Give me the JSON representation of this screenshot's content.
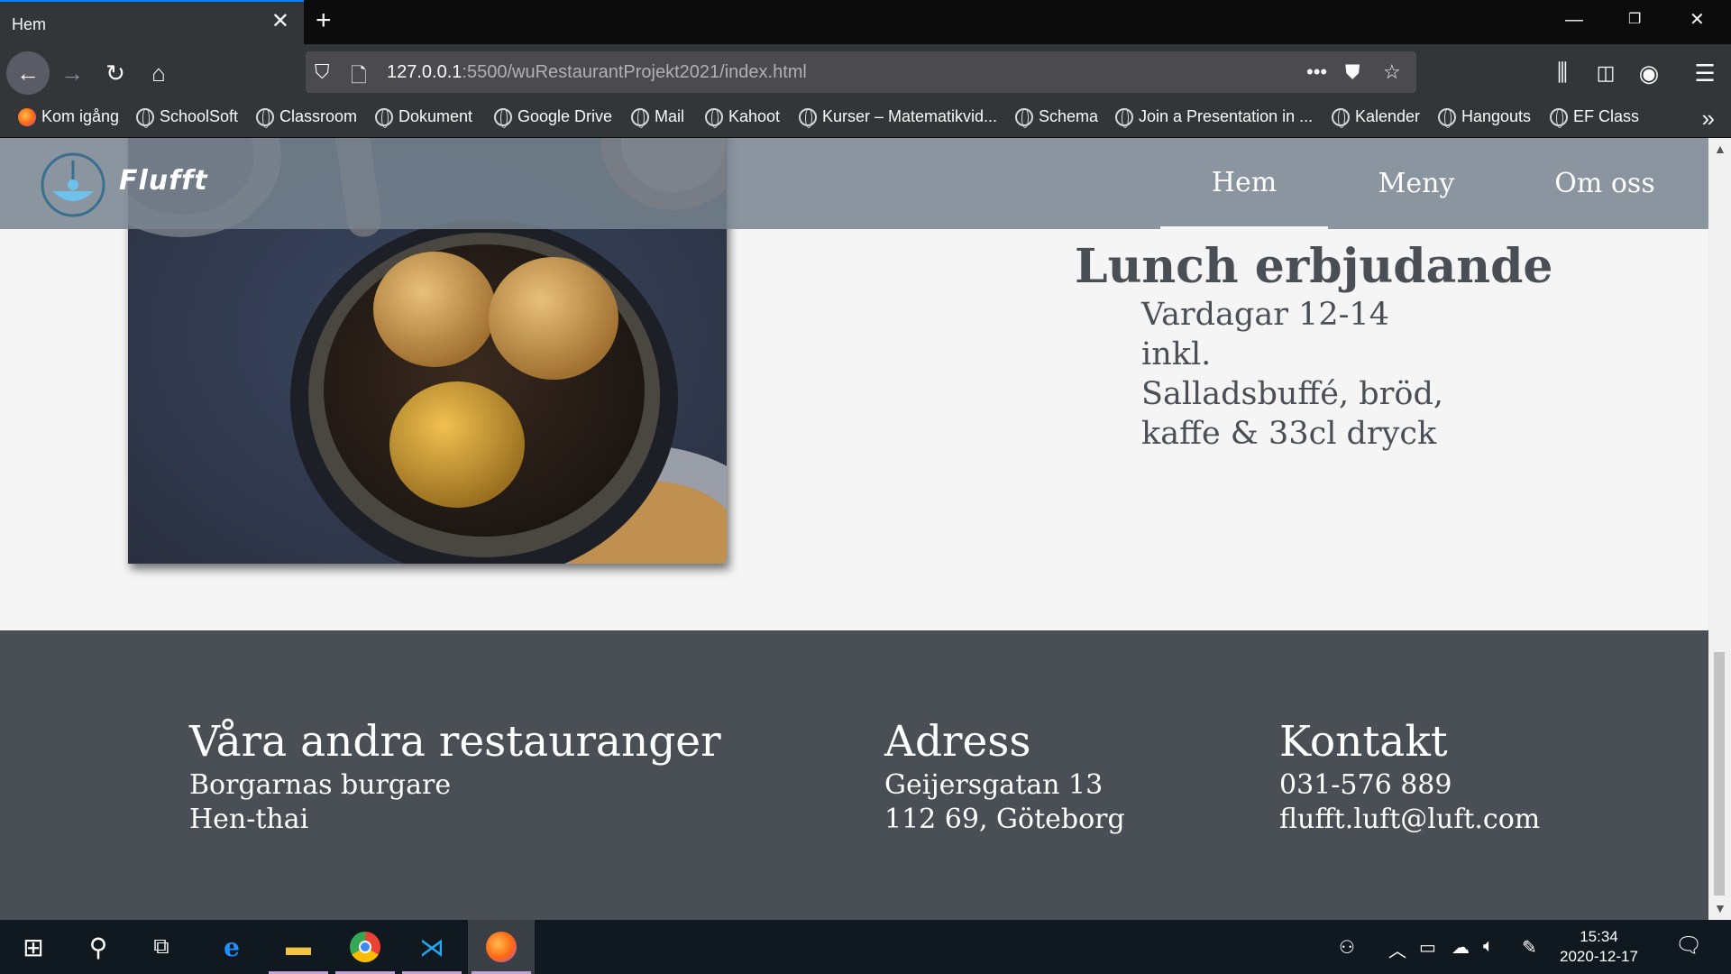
{
  "browser": {
    "tab_title": "Hem",
    "new_tab_symbol": "+",
    "url_host": "127.0.0.1",
    "url_path": ":5500/wuRestaurantProjekt2021/index.html",
    "bookmarks": [
      "Kom igång",
      "SchoolSoft",
      "Classroom",
      "Dokument",
      "Google Drive",
      "Mail",
      "Kahoot",
      "Kurser – Matematikvid...",
      "Schema",
      "Join a Presentation in ...",
      "Kalender",
      "Hangouts",
      "EF Class"
    ]
  },
  "site": {
    "logo_text": "Flufft",
    "nav": [
      "Hem",
      "Meny",
      "Om oss"
    ],
    "lunch": {
      "title": "Lunch erbjudande",
      "lines": [
        "Vardagar 12-14",
        "inkl.",
        "Salladsbuffé, bröd,",
        "kaffe & 33cl dryck"
      ]
    },
    "footer": {
      "col1": {
        "title": "Våra andra restauranger",
        "items": [
          "Borgarnas burgare",
          "Hen-thai"
        ]
      },
      "col2": {
        "title": "Adress",
        "items": [
          "Geijersgatan 13",
          "112 69, Göteborg"
        ]
      },
      "col3": {
        "title": "Kontakt",
        "items": [
          "031-576 889",
          "flufft.luft@luft.com"
        ]
      }
    }
  },
  "taskbar": {
    "time": "15:34",
    "date": "2020-12-17"
  },
  "colors": {
    "header_overlay": "#78848f",
    "footer_bg": "#4a4f55",
    "text_dark": "#4a4f55",
    "page_bg": "#f5f5f5"
  }
}
